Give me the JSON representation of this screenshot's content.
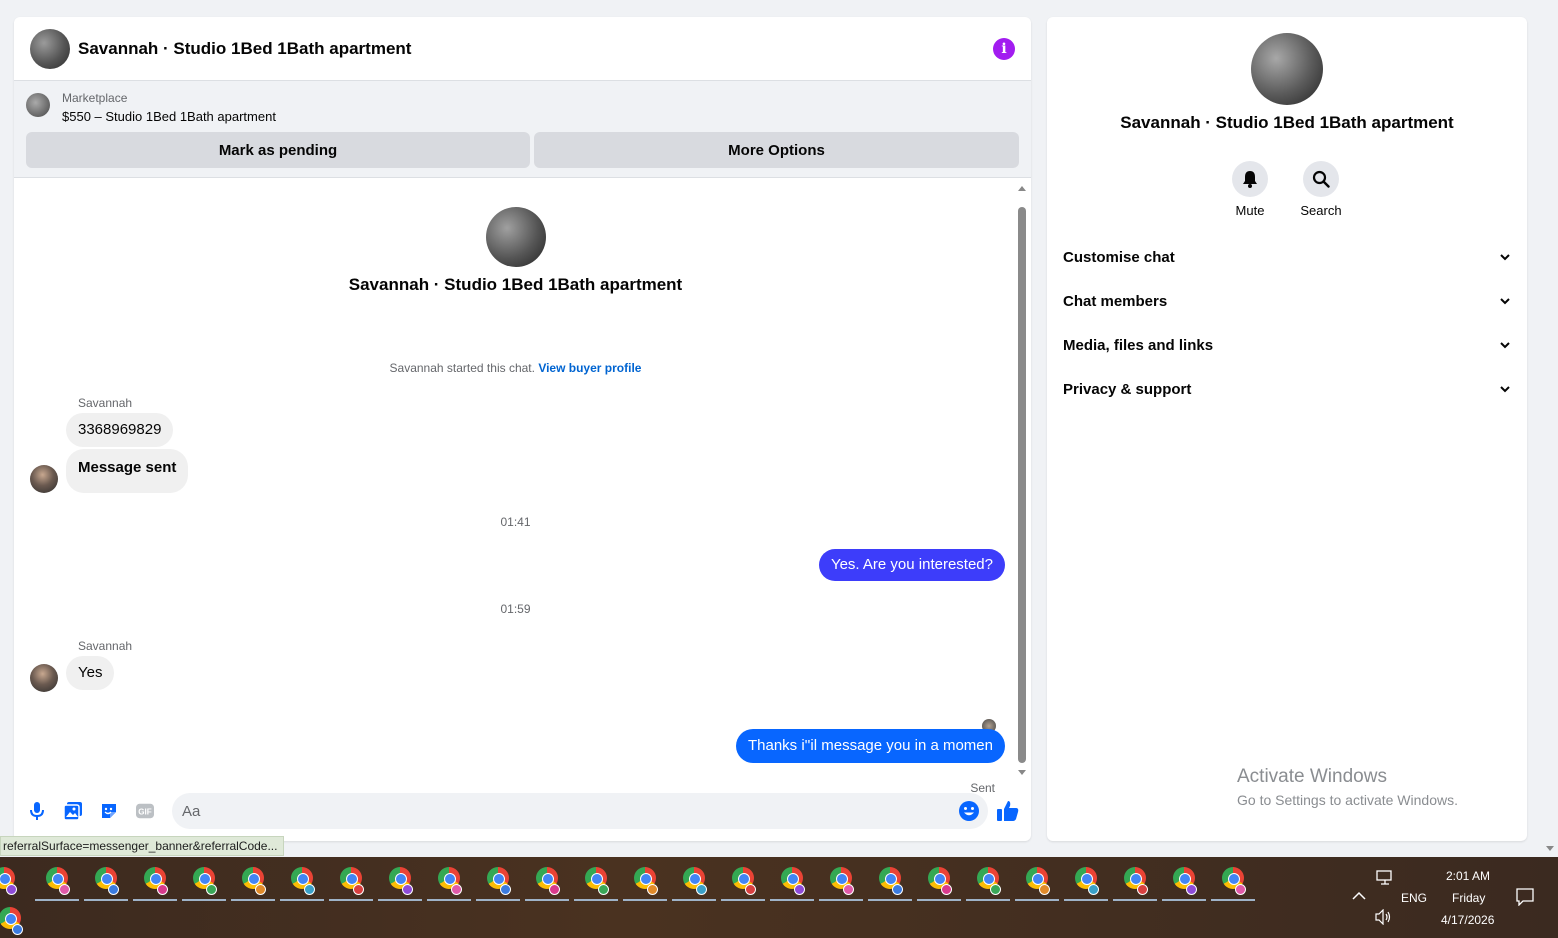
{
  "chat": {
    "title": "Savannah · Studio 1Bed 1Bath apartment",
    "info_icon": "info-icon",
    "marketplace": {
      "label": "Marketplace",
      "item": "$550 – Studio 1Bed 1Bath apartment",
      "mark_pending": "Mark as pending",
      "more_options": "More Options"
    },
    "intro_name": "Savannah · Studio 1Bed 1Bath apartment",
    "started_text": "Savannah started this chat.",
    "view_profile": "View buyer profile",
    "messages": {
      "sender1": "Savannah",
      "msg1": "3368969829",
      "msg2": "Message sent",
      "time1": "01:41",
      "out1": "Yes. Are you interested?",
      "time2": "01:59",
      "sender2": "Savannah",
      "msg3": "Yes",
      "out2": "Thanks i''il message you in a momen",
      "sent_status": "Sent"
    },
    "composer": {
      "placeholder": "Aa",
      "icons": [
        "microphone-icon",
        "image-icon",
        "sticker-icon",
        "gif-icon",
        "emoji-icon",
        "thumbs-up-icon"
      ],
      "gif_label": "GIF"
    },
    "status_url": "referralSurface=messenger_banner&referralCode..."
  },
  "info_panel": {
    "name": "Savannah · Studio 1Bed 1Bath apartment",
    "mute": "Mute",
    "search": "Search",
    "sections": [
      "Customise chat",
      "Chat members",
      "Media, files and links",
      "Privacy & support"
    ]
  },
  "watermark": {
    "line1": "Activate Windows",
    "line2": "Go to Settings to activate Windows."
  },
  "taskbar": {
    "app_count": 27,
    "language": "ENG",
    "time": "2:01 AM",
    "day": "Friday",
    "date": "4/17/2026"
  },
  "colors": {
    "accent_blue": "#0866ff",
    "bubble_blue_alt": "#3d3dfa",
    "info_purple": "#a21cf0",
    "link_blue": "#0064d1"
  }
}
